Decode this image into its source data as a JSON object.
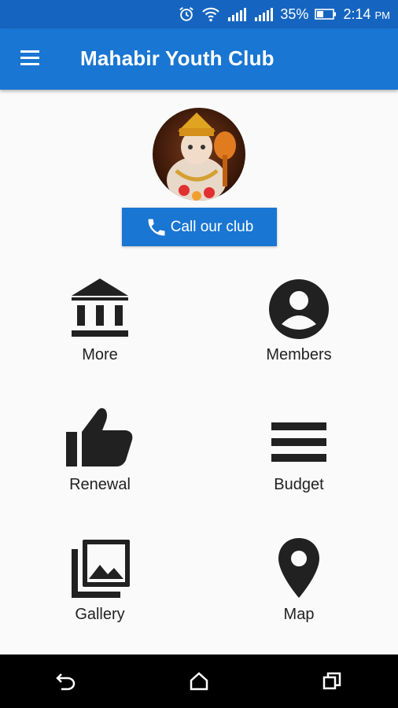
{
  "status_bar": {
    "battery": "35%",
    "time": "2:14",
    "ampm": "PM"
  },
  "app_bar": {
    "title": "Mahabir Youth Club"
  },
  "call_button": {
    "label": "Call our club"
  },
  "menu": [
    {
      "label": "More",
      "icon": "bank-icon"
    },
    {
      "label": "Members",
      "icon": "account-circle-icon"
    },
    {
      "label": "Renewal",
      "icon": "thumb-up-icon"
    },
    {
      "label": "Budget",
      "icon": "list-lines-icon"
    },
    {
      "label": "Gallery",
      "icon": "photo-library-icon"
    },
    {
      "label": "Map",
      "icon": "location-pin-icon"
    }
  ],
  "colors": {
    "primary": "#1976d2",
    "status": "#1565c0",
    "icon": "#212121"
  }
}
